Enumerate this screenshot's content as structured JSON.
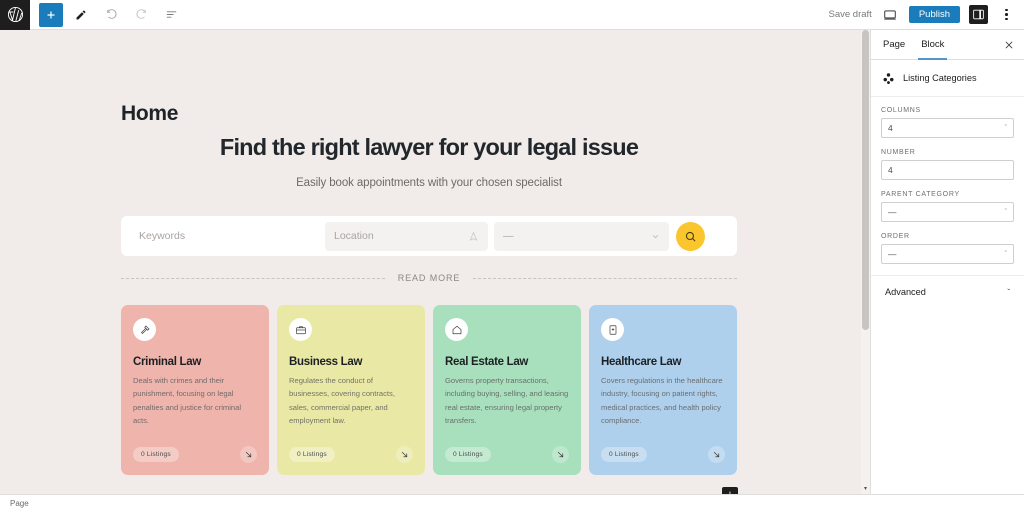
{
  "topbar": {
    "logo_icon": "wordpress-logo-icon",
    "add_block_icon": "plus-icon",
    "tools_icon": "pencil-icon",
    "undo_icon": "undo-arrow-icon",
    "redo_icon": "redo-arrow-icon",
    "list_view_icon": "document-overview-icon",
    "save_draft_label": "Save draft",
    "preview_icon": "desktop-preview-icon",
    "publish_label": "Publish",
    "settings_icon": "settings-sidebar-icon",
    "options_icon": "kebab-menu-icon"
  },
  "canvas": {
    "page_title": "Home",
    "hero": {
      "heading": "Find the right lawyer for your legal issue",
      "subheading": "Easily book appointments with your chosen specialist"
    },
    "search": {
      "keywords_placeholder": "Keywords",
      "location_placeholder": "Location",
      "location_icon": "map-pin-icon",
      "category_value": "—",
      "category_chevron_icon": "chevron-down-icon",
      "search_icon": "search-magnifier-icon"
    },
    "divider_label": "READ MORE",
    "cards": [
      {
        "title": "Criminal Law",
        "description": "Deals with crimes and their punishment, focusing on legal penalties and justice for criminal acts.",
        "listings": "0 Listings",
        "icon": "gavel-icon",
        "bg": "#efb4ac",
        "arrow_icon": "arrow-down-right-icon"
      },
      {
        "title": "Business Law",
        "description": "Regulates the conduct of businesses, covering contracts, sales, commercial paper, and employment law.",
        "listings": "0 Listings",
        "icon": "briefcase-icon",
        "bg": "#e9e9a5",
        "arrow_icon": "arrow-down-right-icon"
      },
      {
        "title": "Real Estate Law",
        "description": "Governs property transactions, including buying, selling, and leasing real estate, ensuring legal property transfers.",
        "listings": "0 Listings",
        "icon": "house-icon",
        "bg": "#a8e0bd",
        "arrow_icon": "arrow-down-right-icon"
      },
      {
        "title": "Healthcare Law",
        "description": "Covers regulations in the healthcare industry, focusing on patient rights, medical practices, and health policy compliance.",
        "listings": "0 Listings",
        "icon": "medical-book-icon",
        "bg": "#aed0ec",
        "arrow_icon": "arrow-down-right-icon"
      }
    ],
    "add_block_label": "+"
  },
  "sidebar": {
    "tabs": [
      {
        "label": "Page",
        "active": false
      },
      {
        "label": "Block",
        "active": true
      }
    ],
    "close_icon": "close-x-icon",
    "block": {
      "icon": "listing-categories-icon",
      "name": "Listing Categories"
    },
    "fields": [
      {
        "label": "COLUMNS",
        "value": "4",
        "type": "select",
        "chevron": "ˇ"
      },
      {
        "label": "NUMBER",
        "value": "4",
        "type": "input",
        "chevron": ""
      },
      {
        "label": "PARENT CATEGORY",
        "value": "—",
        "type": "select",
        "chevron": "ˇ"
      },
      {
        "label": "ORDER",
        "value": "—",
        "type": "select",
        "chevron": "ˇ"
      }
    ],
    "advanced_label": "Advanced",
    "advanced_chevron": "ˇ"
  },
  "statusbar": {
    "breadcrumb": "Page"
  },
  "colors": {
    "accent_blue": "#1a7cba",
    "tab_underline": "#5596c8",
    "search_button": "#fbc52d",
    "canvas_bg": "#f1ecea"
  }
}
